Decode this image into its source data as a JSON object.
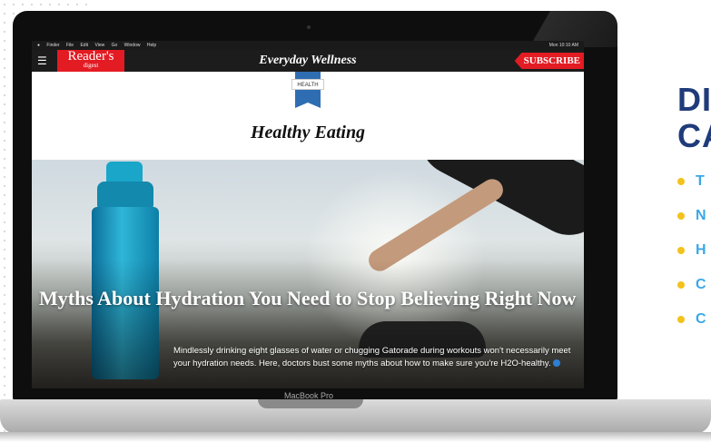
{
  "mac_menubar": {
    "items": [
      "Finder",
      "File",
      "Edit",
      "View",
      "Go",
      "Window",
      "Help"
    ],
    "right_text": "Mon 10:10 AM"
  },
  "site": {
    "logo_main": "Reader's",
    "logo_sub": "digest",
    "title": "Everyday Wellness",
    "subscribe": "SUBSCRIBE"
  },
  "category_badge": "HEALTH",
  "section_title": "Healthy Eating",
  "article": {
    "title": "Myths About Hydration You Need to Stop Believing Right Now",
    "description": "Mindlessly drinking eight glasses of water or chugging Gatorade during workouts won't necessarily meet your hydration needs. Here, doctors bust some myths about how to make sure you're H2O-healthy."
  },
  "device_label": "MacBook Pro",
  "side": {
    "heading_line1": "DI",
    "heading_line2": "CA",
    "items": [
      "T",
      "N",
      "H",
      "C",
      "C"
    ]
  },
  "colors": {
    "brand_red": "#e31b23",
    "header_dark": "#1c1c1c",
    "side_heading": "#1f3b7a",
    "side_item": "#3aa8e6",
    "bullet": "#f3c21b"
  },
  "icons": [
    "menu-icon",
    "apple-icon",
    "info-dot-icon"
  ]
}
